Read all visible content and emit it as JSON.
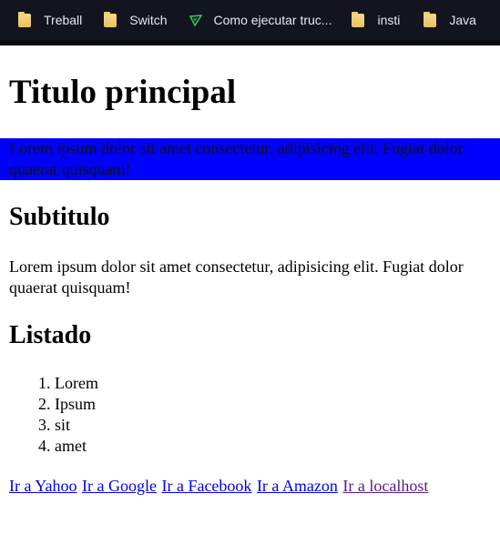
{
  "bookmarks": [
    {
      "label": "Treball",
      "icon": "folder-icon"
    },
    {
      "label": "Switch",
      "icon": "folder-icon"
    },
    {
      "label": "Como ejecutar truc...",
      "icon": "site-flag-icon"
    },
    {
      "label": "insti",
      "icon": "folder-icon"
    },
    {
      "label": "Java",
      "icon": "folder-icon"
    }
  ],
  "page": {
    "title": "Titulo principal",
    "highlight_paragraph_line1": "Lorem ipsum dolor sit amet consectetur, adipisicing elit. Fugiat dolor",
    "highlight_paragraph_line2": "quaerat quisquam!",
    "subtitle": "Subtitulo",
    "paragraph_line1": "Lorem ipsum dolor sit amet consectetur, adipisicing elit. Fugiat dolor",
    "paragraph_line2": "quaerat quisquam!",
    "list_heading": "Listado",
    "list_items": [
      "Lorem",
      "Ipsum",
      "sit",
      "amet"
    ],
    "links": [
      {
        "label": "Ir a Yahoo",
        "visited": false
      },
      {
        "label": "Ir a Google",
        "visited": false
      },
      {
        "label": "Ir a Facebook",
        "visited": false
      },
      {
        "label": "Ir a Amazon",
        "visited": false
      },
      {
        "label": "Ir a localhost",
        "visited": true
      }
    ]
  },
  "colors": {
    "bookmarks_bar_bg": "#12141f",
    "highlight_bg": "#0000ff",
    "link": "#0000ee",
    "link_visited": "#551a8b"
  }
}
